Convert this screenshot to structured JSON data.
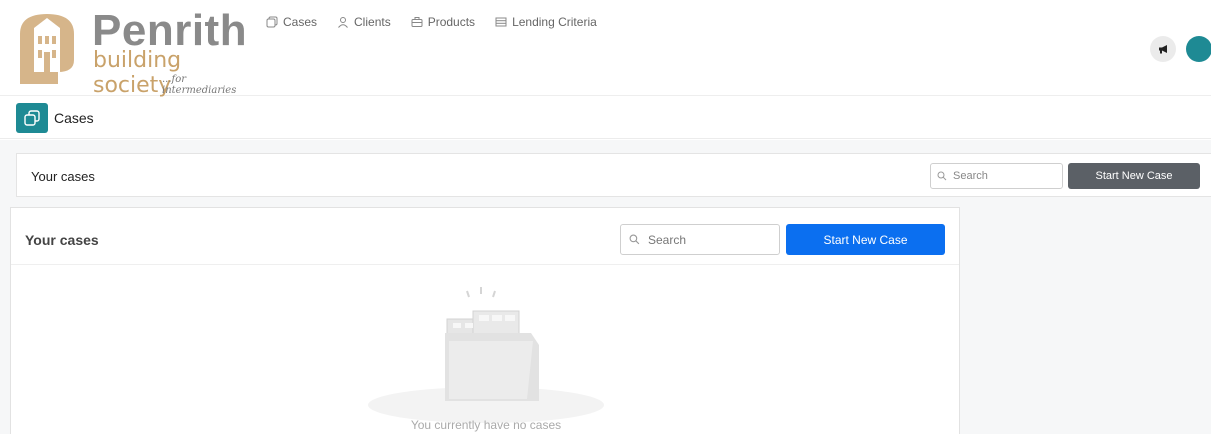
{
  "brand": {
    "name": "Penrith",
    "sub": "building society",
    "tagline": "...for intermediaries",
    "mark_color": "#d6b58a",
    "name_color": "#8a8a8a",
    "sub_color": "#c9a26a"
  },
  "nav": [
    {
      "label": "Cases",
      "icon": "cases-icon"
    },
    {
      "label": "Clients",
      "icon": "user-icon"
    },
    {
      "label": "Products",
      "icon": "briefcase-icon"
    },
    {
      "label": "Lending Criteria",
      "icon": "list-icon"
    }
  ],
  "header_actions": {
    "announcements_icon": "megaphone-icon",
    "avatar_color": "#1e8a94"
  },
  "page": {
    "title": "Cases",
    "icon": "cases-icon",
    "accent": "#1e8a94"
  },
  "card_background": {
    "title": "Your cases",
    "search_placeholder": "Search",
    "button_label": "Start New Case",
    "button_color": "#5b6066"
  },
  "card_foreground": {
    "title": "Your cases",
    "search_placeholder": "Search",
    "button_label": "Start New Case",
    "button_color": "#0b6ff0",
    "empty_message": "You currently have no cases",
    "empty_icon": "empty-folder-icon"
  }
}
